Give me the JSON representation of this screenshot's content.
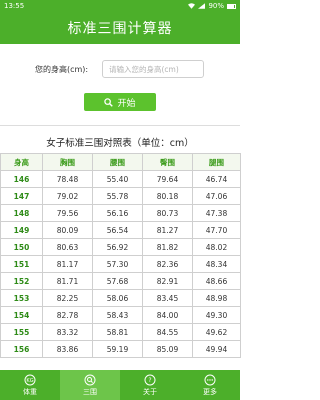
{
  "status_bar": {
    "time": "13:55",
    "battery": "90%"
  },
  "title": "标准三围计算器",
  "form": {
    "height_label": "您的身高(cm):",
    "height_placeholder": "请输入您的身高(cm)",
    "height_value": "",
    "start_label": "开始"
  },
  "table": {
    "title": "女子标准三围对照表（单位：cm）",
    "headers": [
      "身高",
      "胸围",
      "腰围",
      "臀围",
      "腿围"
    ],
    "rows": [
      [
        "146",
        "78.48",
        "55.40",
        "79.64",
        "46.74"
      ],
      [
        "147",
        "79.02",
        "55.78",
        "80.18",
        "47.06"
      ],
      [
        "148",
        "79.56",
        "56.16",
        "80.73",
        "47.38"
      ],
      [
        "149",
        "80.09",
        "56.54",
        "81.27",
        "47.70"
      ],
      [
        "150",
        "80.63",
        "56.92",
        "81.82",
        "48.02"
      ],
      [
        "151",
        "81.17",
        "57.30",
        "82.36",
        "48.34"
      ],
      [
        "152",
        "81.71",
        "57.68",
        "82.91",
        "48.66"
      ],
      [
        "153",
        "82.25",
        "58.06",
        "83.45",
        "48.98"
      ],
      [
        "154",
        "82.78",
        "58.43",
        "84.00",
        "49.30"
      ],
      [
        "155",
        "83.32",
        "58.81",
        "84.55",
        "49.62"
      ],
      [
        "156",
        "83.86",
        "59.19",
        "85.09",
        "49.94"
      ]
    ]
  },
  "tabs": [
    {
      "label": "体重",
      "icon": "kg-icon"
    },
    {
      "label": "三围",
      "icon": "search-icon"
    },
    {
      "label": "关于",
      "icon": "question-icon"
    },
    {
      "label": "更多",
      "icon": "more-icon"
    }
  ],
  "colors": {
    "brand_green": "#4caf2a",
    "button_green": "#5cc22d",
    "header_text_green": "#3c9c1c"
  }
}
